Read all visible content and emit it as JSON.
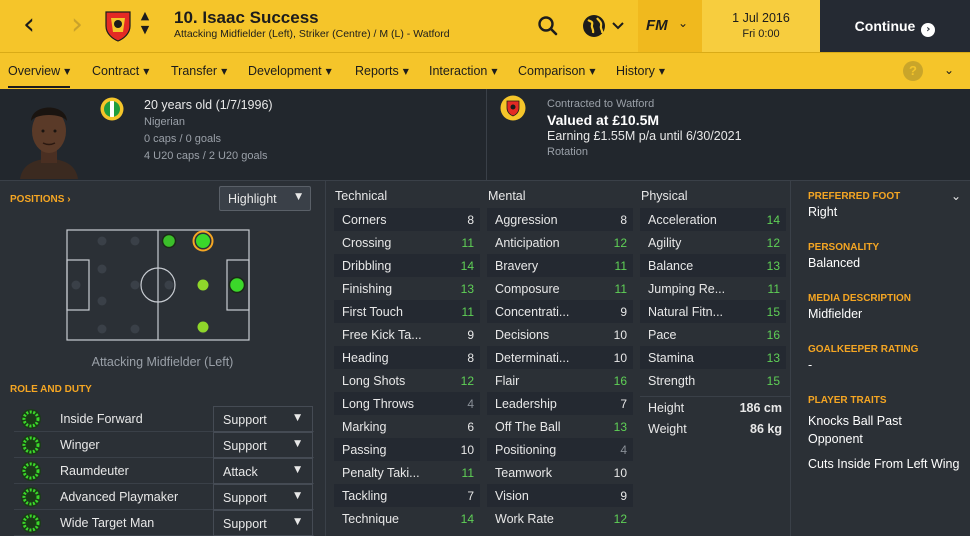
{
  "topbar": {
    "player_name": "10. Isaac Success",
    "positions": "Attacking Midfielder (Left), Striker (Centre) / M (L) - Watford",
    "date": "1 Jul 2016",
    "time": "Fri 0:00",
    "continue_label": "Continue",
    "fm_label": "FM",
    "colors": {
      "accent": "#f5c52a",
      "dark": "#252a33"
    }
  },
  "menu": {
    "items": [
      "Overview",
      "Contract",
      "Transfer",
      "Development",
      "Reports",
      "Interaction",
      "Comparison",
      "History"
    ],
    "help": "?"
  },
  "header": {
    "age": "20 years old (1/7/1996)",
    "nationality": "Nigerian",
    "caps": "0 caps / 0 goals",
    "u20": "4 U20 caps / 2 U20 goals",
    "contract": "Contracted to Watford",
    "value": "Valued at £10.5M",
    "earning": "Earning £1.55M p/a until 6/30/2021",
    "status": "Rotation"
  },
  "positions": {
    "title": "POSITIONS",
    "highlight": "Highlight",
    "label": "Attacking Midfielder (Left)"
  },
  "roles": {
    "title": "ROLE AND DUTY",
    "items": [
      {
        "name": "Inside Forward",
        "duty": "Support"
      },
      {
        "name": "Winger",
        "duty": "Support"
      },
      {
        "name": "Raumdeuter",
        "duty": "Attack"
      },
      {
        "name": "Advanced Playmaker",
        "duty": "Support"
      },
      {
        "name": "Wide Target Man",
        "duty": "Support"
      }
    ]
  },
  "attributes": {
    "technical_title": "Technical",
    "mental_title": "Mental",
    "physical_title": "Physical",
    "technical": [
      {
        "name": "Corners",
        "value": "8"
      },
      {
        "name": "Crossing",
        "value": "11"
      },
      {
        "name": "Dribbling",
        "value": "14"
      },
      {
        "name": "Finishing",
        "value": "13"
      },
      {
        "name": "First Touch",
        "value": "11"
      },
      {
        "name": "Free Kick Ta...",
        "value": "9"
      },
      {
        "name": "Heading",
        "value": "8"
      },
      {
        "name": "Long Shots",
        "value": "12"
      },
      {
        "name": "Long Throws",
        "value": "4"
      },
      {
        "name": "Marking",
        "value": "6"
      },
      {
        "name": "Passing",
        "value": "10"
      },
      {
        "name": "Penalty Taki...",
        "value": "11"
      },
      {
        "name": "Tackling",
        "value": "7"
      },
      {
        "name": "Technique",
        "value": "14"
      }
    ],
    "mental": [
      {
        "name": "Aggression",
        "value": "8"
      },
      {
        "name": "Anticipation",
        "value": "12"
      },
      {
        "name": "Bravery",
        "value": "11"
      },
      {
        "name": "Composure",
        "value": "11"
      },
      {
        "name": "Concentrati...",
        "value": "9"
      },
      {
        "name": "Decisions",
        "value": "10"
      },
      {
        "name": "Determinati...",
        "value": "10"
      },
      {
        "name": "Flair",
        "value": "16"
      },
      {
        "name": "Leadership",
        "value": "7"
      },
      {
        "name": "Off The Ball",
        "value": "13"
      },
      {
        "name": "Positioning",
        "value": "4"
      },
      {
        "name": "Teamwork",
        "value": "10"
      },
      {
        "name": "Vision",
        "value": "9"
      },
      {
        "name": "Work Rate",
        "value": "12"
      }
    ],
    "physical": [
      {
        "name": "Acceleration",
        "value": "14"
      },
      {
        "name": "Agility",
        "value": "12"
      },
      {
        "name": "Balance",
        "value": "13"
      },
      {
        "name": "Jumping Re...",
        "value": "11"
      },
      {
        "name": "Natural Fitn...",
        "value": "15"
      },
      {
        "name": "Pace",
        "value": "16"
      },
      {
        "name": "Stamina",
        "value": "13"
      },
      {
        "name": "Strength",
        "value": "15"
      }
    ],
    "height_label": "Height",
    "height": "186 cm",
    "weight_label": "Weight",
    "weight": "86 kg"
  },
  "details": {
    "foot_label": "PREFERRED FOOT",
    "foot": "Right",
    "personality_label": "PERSONALITY",
    "personality": "Balanced",
    "media_label": "MEDIA DESCRIPTION",
    "media": "Midfielder",
    "gk_label": "GOALKEEPER RATING",
    "gk": "-",
    "traits_label": "PLAYER TRAITS",
    "traits": [
      "Knocks Ball Past Opponent",
      "Cuts Inside From Left Wing"
    ]
  }
}
